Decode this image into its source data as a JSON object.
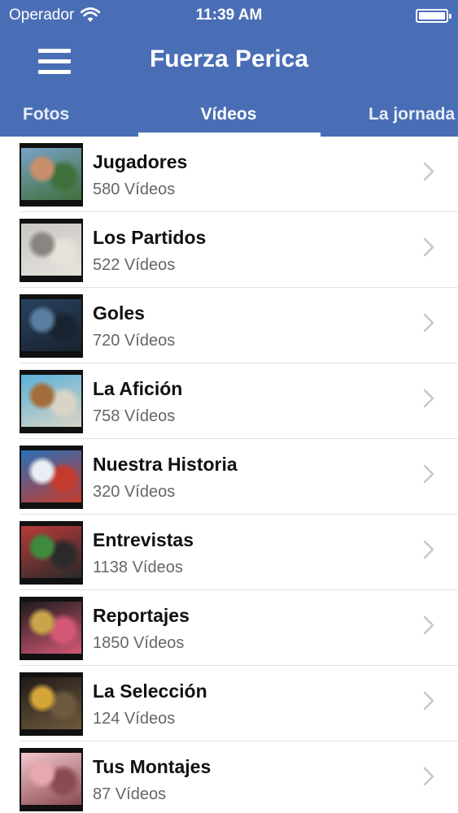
{
  "status_bar": {
    "carrier": "Operador",
    "time": "11:39 AM"
  },
  "nav": {
    "title": "Fuerza Perica",
    "menu_icon": "hamburger-menu-icon"
  },
  "tabs": [
    {
      "label": "Fotos",
      "selected": false
    },
    {
      "label": "Vídeos",
      "selected": true
    },
    {
      "label": "La jornada",
      "selected": false
    }
  ],
  "colors": {
    "header": "#4a6eb5",
    "tab_indicator": "#ffffff",
    "chevron": "#c7c7cc"
  },
  "categories": [
    {
      "title": "Jugadores",
      "count": "580 Vídeos",
      "thumb": [
        "#7aa3c9",
        "#c98f6a",
        "#3f6f3a"
      ]
    },
    {
      "title": "Los Partidos",
      "count": "522 Vídeos",
      "thumb": [
        "#c9c7c2",
        "#8a8580",
        "#e6e3dd"
      ]
    },
    {
      "title": "Goles",
      "count": "720 Vídeos",
      "thumb": [
        "#28425e",
        "#5a7ea0",
        "#18232f"
      ]
    },
    {
      "title": "La Afición",
      "count": "758 Vídeos",
      "thumb": [
        "#5ab2d8",
        "#a36c3a",
        "#d9d4c6"
      ]
    },
    {
      "title": "Nuestra Historia",
      "count": "320 Vídeos",
      "thumb": [
        "#2a6fb8",
        "#e9eef3",
        "#c43b2e"
      ]
    },
    {
      "title": "Entrevistas",
      "count": "1138 Vídeos",
      "thumb": [
        "#b93a3a",
        "#3f8a3c",
        "#2a2a2a"
      ]
    },
    {
      "title": "Reportajes",
      "count": "1850 Vídeos",
      "thumb": [
        "#1c1c1c",
        "#c9a44b",
        "#d45876"
      ]
    },
    {
      "title": "La Selección",
      "count": "124 Vídeos",
      "thumb": [
        "#201a17",
        "#d4a537",
        "#6d5a3e"
      ]
    },
    {
      "title": "Tus Montajes",
      "count": "87 Vídeos",
      "thumb": [
        "#f2c7cc",
        "#e8a8b0",
        "#8a4b52"
      ]
    }
  ]
}
